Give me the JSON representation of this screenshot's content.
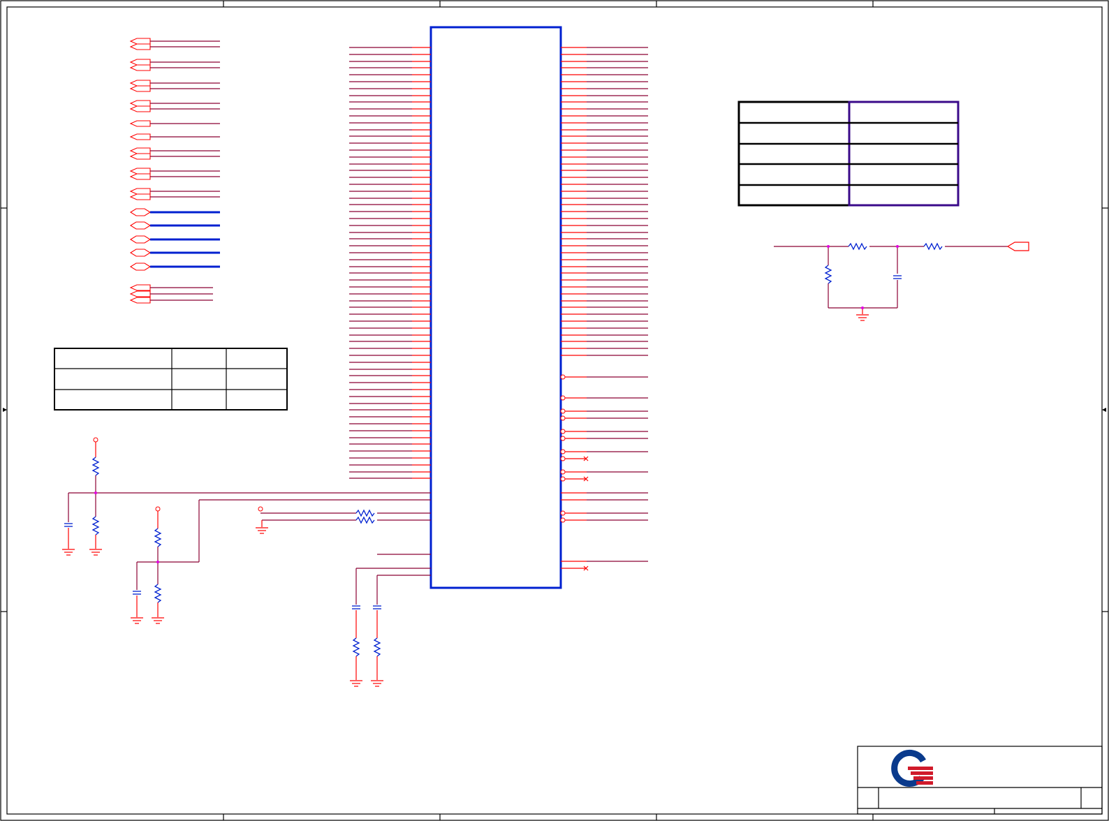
{
  "colors": {
    "net_red": "#ff0000",
    "net_dark": "#8b0033",
    "component_blue": "#0020d0",
    "table_purple": "#3a0a8a",
    "junction_magenta": "#e000e0",
    "logo_blue": "#0a3a8c",
    "logo_red": "#d01a2a"
  },
  "icons": {
    "frame": "schematic-border-frame",
    "logo": "quanta-style-logo-icon",
    "ground": "ground-symbol-icon",
    "resistor": "resistor-zigzag-icon",
    "capacitor": "capacitor-icon",
    "offpage": "off-page-connector-icon",
    "noconnect": "no-connect-x-icon"
  },
  "text": {}
}
